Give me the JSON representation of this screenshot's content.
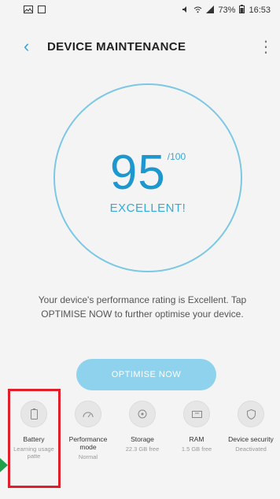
{
  "status_bar": {
    "left_icons": [
      "image-icon",
      "gallery-icon"
    ],
    "right_icons": [
      "mute-icon",
      "wifi-icon",
      "signal-icon"
    ],
    "battery": "73%",
    "time": "16:53"
  },
  "app_bar": {
    "title": "DEVICE MAINTENANCE"
  },
  "score": {
    "value": "95",
    "max": "/100",
    "label": "EXCELLENT!"
  },
  "description": "Your device's performance rating is Excellent. Tap OPTIMISE NOW to further optimise your device.",
  "optimise_button": "OPTIMISE NOW",
  "cards": [
    {
      "name": "Battery",
      "value": "Learning usage patte",
      "icon": "battery-icon"
    },
    {
      "name": "Performance mode",
      "value": "Normal",
      "icon": "speedometer-icon"
    },
    {
      "name": "Storage",
      "value": "22.3 GB free",
      "icon": "storage-icon"
    },
    {
      "name": "RAM",
      "value": "1.5 GB free",
      "icon": "ram-icon"
    },
    {
      "name": "Device security",
      "value": "Deactivated",
      "icon": "shield-icon"
    }
  ],
  "colors": {
    "accent": "#1e97cf",
    "ring": "#7cc8e4",
    "button": "#8fd2ee",
    "highlight": "#e01f2a",
    "arrow": "#1fa049"
  }
}
